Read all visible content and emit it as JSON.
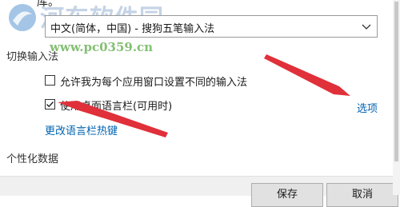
{
  "window": {
    "fragment_text": "库。"
  },
  "watermark": {
    "title": "河东软件园",
    "url": "www.pc0359.cn"
  },
  "language_dropdown": {
    "value": "中文(简体，中国) - 搜狗五笔输入法"
  },
  "switch_section": {
    "title": "切换输入法",
    "option_per_app": {
      "label": "允许我为每个应用窗口设置不同的输入法",
      "checked": false
    },
    "option_language_bar": {
      "label": "使用桌面语言栏(可用时)",
      "checked": true
    },
    "options_link": "选项",
    "hotkeys_link": "更改语言栏热键"
  },
  "personalize_section": {
    "title": "个性化数据"
  },
  "footer": {
    "save_label": "保存",
    "cancel_label": "取消"
  },
  "colors": {
    "link": "#0063b1",
    "annotation_arrow": "#e0303a"
  }
}
